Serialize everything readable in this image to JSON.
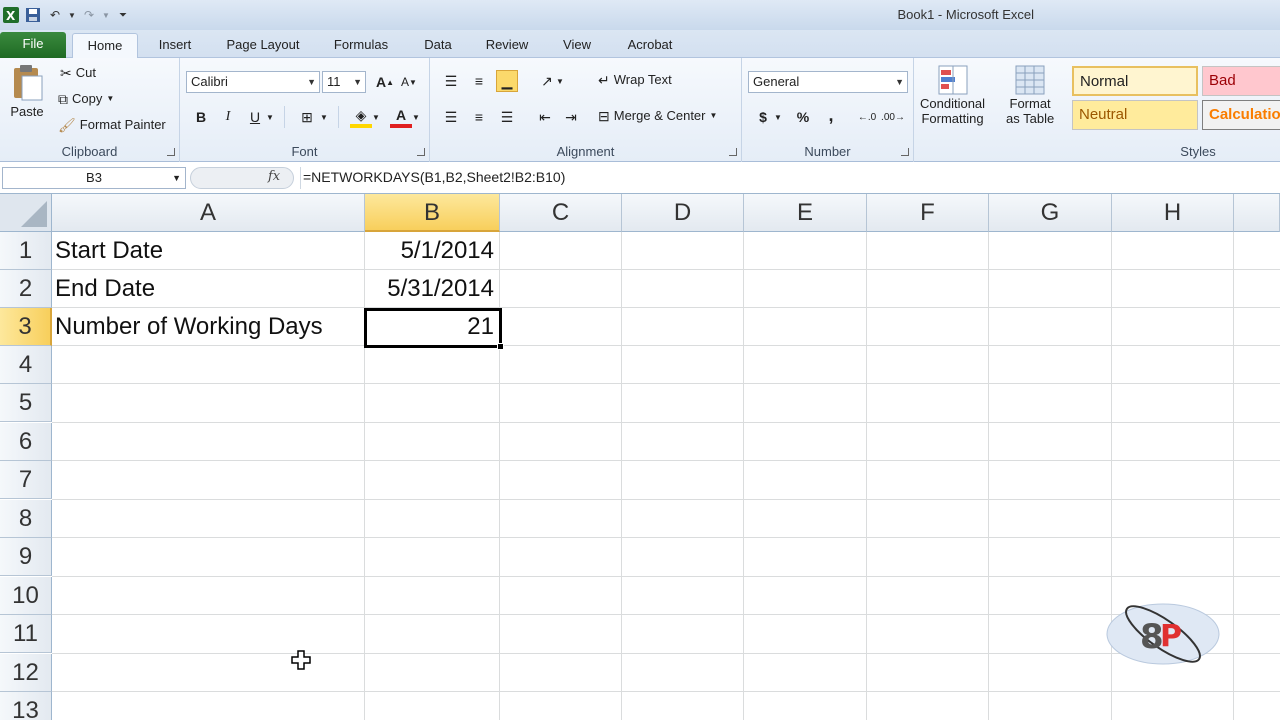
{
  "window": {
    "title": "Book1 - Microsoft Excel"
  },
  "qat": {
    "icons": [
      "excel-logo-icon",
      "save-icon",
      "undo-icon",
      "redo-icon",
      "customize-icon"
    ]
  },
  "tabs": [
    {
      "label": "File"
    },
    {
      "label": "Home"
    },
    {
      "label": "Insert"
    },
    {
      "label": "Page Layout"
    },
    {
      "label": "Formulas"
    },
    {
      "label": "Data"
    },
    {
      "label": "Review"
    },
    {
      "label": "View"
    },
    {
      "label": "Acrobat"
    }
  ],
  "clipboard": {
    "group": "Clipboard",
    "paste": "Paste",
    "cut": "Cut",
    "copy": "Copy",
    "painter": "Format Painter"
  },
  "font": {
    "group": "Font",
    "name": "Calibri",
    "size": "11",
    "bold": "B",
    "italic": "I",
    "underline": "U",
    "font_color": "A"
  },
  "alignment": {
    "group": "Alignment",
    "wrap": "Wrap Text",
    "merge": "Merge & Center"
  },
  "number": {
    "group": "Number",
    "format": "General",
    "currency": "$",
    "percent": "%",
    "comma": ","
  },
  "styles": {
    "group": "Styles",
    "conditional_1": "Conditional",
    "conditional_2": "Formatting",
    "table_1": "Format",
    "table_2": "as Table",
    "normal": "Normal",
    "bad": "Bad",
    "neutral": "Neutral",
    "calculation": "Calculation"
  },
  "formula_bar": {
    "name_box": "B3",
    "fx": "fx",
    "formula": "=NETWORKDAYS(B1,B2,Sheet2!B2:B10)"
  },
  "columns": [
    "A",
    "B",
    "C",
    "D",
    "E",
    "F",
    "G",
    "H"
  ],
  "rows": [
    "1",
    "2",
    "3",
    "4",
    "5",
    "6",
    "7",
    "8",
    "9",
    "10",
    "11",
    "12",
    "13"
  ],
  "cells": {
    "A1": "Start Date",
    "B1": "5/1/2014",
    "A2": "End Date",
    "B2": "5/31/2014",
    "A3": "Number of Working Days",
    "B3": "21"
  },
  "colors": {
    "file_tab": "#2a7a2f",
    "selection_header": "#f8cf5c",
    "normal_style": "#fff5d0",
    "bad_style": "#ffc7ce",
    "neutral_style": "#ffeb9c",
    "calculation_style": "#f2f2f2"
  }
}
